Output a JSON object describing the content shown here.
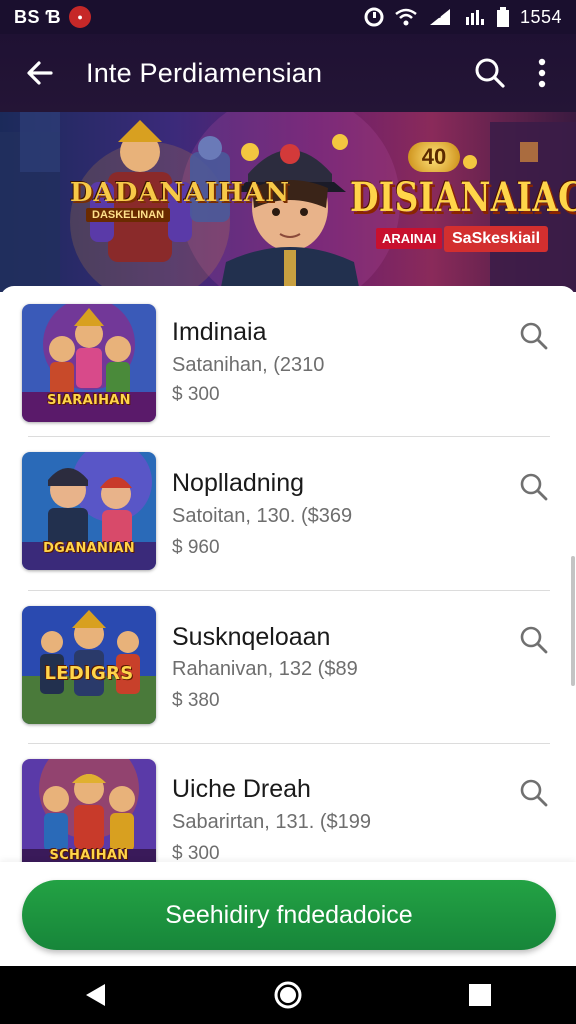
{
  "status_bar": {
    "carrier": "BS Ɓ",
    "time": "1554",
    "icons": [
      "notification-dot-icon",
      "alarm-icon",
      "wifi-icon",
      "signal-icon",
      "data-icon",
      "battery-icon"
    ]
  },
  "app_bar": {
    "title": "Inte Perdiamensian",
    "icons": [
      "back-arrow-icon",
      "search-icon",
      "more-vert-icon"
    ]
  },
  "banner": {
    "left_logo": "DADANAIHAN",
    "left_logo_sub": "DASKELINAN",
    "right_logo": "DISIANAIAC",
    "badge": "40",
    "tag_left": "ARAINAI",
    "tag_right": "SaSkeskiail"
  },
  "items": [
    {
      "name": "Imdinaia",
      "subtitle": "Satanihan, (2310",
      "price": "$ 300",
      "thumb_label": "SIARAIHAN",
      "thumb_colors": [
        "#3a5ab8",
        "#8a2a8a",
        "#d9a030"
      ]
    },
    {
      "name": "Noplladning",
      "subtitle": "Satoitan, 130. ($369",
      "price": "$ 960",
      "thumb_label": "DGANANIAN",
      "thumb_colors": [
        "#2a6ab8",
        "#7a4ad0",
        "#d84a6a"
      ]
    },
    {
      "name": "Susknqeloaan",
      "subtitle": "Rahanivan, 132 ($89",
      "price": "$ 380",
      "thumb_label": "LEDIGRS",
      "thumb_colors": [
        "#2a4ab0",
        "#4a7a3a",
        "#d8a020"
      ]
    },
    {
      "name": "Uiche Dreah",
      "subtitle": "Sabarirtan, 131. ($199",
      "price": "$ 300",
      "thumb_label": "SCHAIHAN",
      "thumb_colors": [
        "#5a3aa8",
        "#d8502a",
        "#e0b030"
      ]
    }
  ],
  "cta": {
    "label": "Seehidiry fndedadoice"
  },
  "nav_bar": {
    "icons": [
      "back-triangle-icon",
      "home-circle-icon",
      "recents-square-icon"
    ]
  },
  "colors": {
    "app_bar": "#1f1133",
    "cta_green": "#1e9a40",
    "text_primary": "#1a1a1a",
    "text_secondary": "#6e6e6e"
  }
}
